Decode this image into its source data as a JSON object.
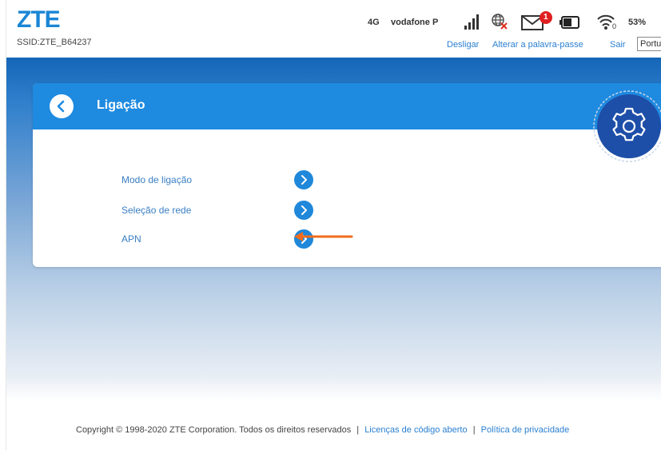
{
  "header": {
    "logo": "ZTE",
    "ssid": "SSID:ZTE_B64237",
    "network_type": "4G",
    "carrier": "vodafone P",
    "sms_count": "1",
    "battery_percent": "53%",
    "wifi_clients": "0",
    "links": {
      "disconnect": "Desligar",
      "change_password": "Alterar a palavra-passe",
      "logout": "Sair"
    },
    "language_selected": "Portu"
  },
  "card": {
    "title": "Ligação",
    "items": [
      {
        "label": "Modo de ligação"
      },
      {
        "label": "Seleção de rede"
      },
      {
        "label": "APN"
      }
    ]
  },
  "footer": {
    "copyright": "Copyright © 1998-2020 ZTE Corporation. Todos os direitos reservados",
    "open_source": "Licenças de código aberto",
    "privacy": "Política de privacidade",
    "separator": "|"
  },
  "colors": {
    "brand": "#1a86d6",
    "header_bar": "#1e8ae0",
    "badge": "#e02020",
    "annotation_arrow": "#f26b1d"
  }
}
